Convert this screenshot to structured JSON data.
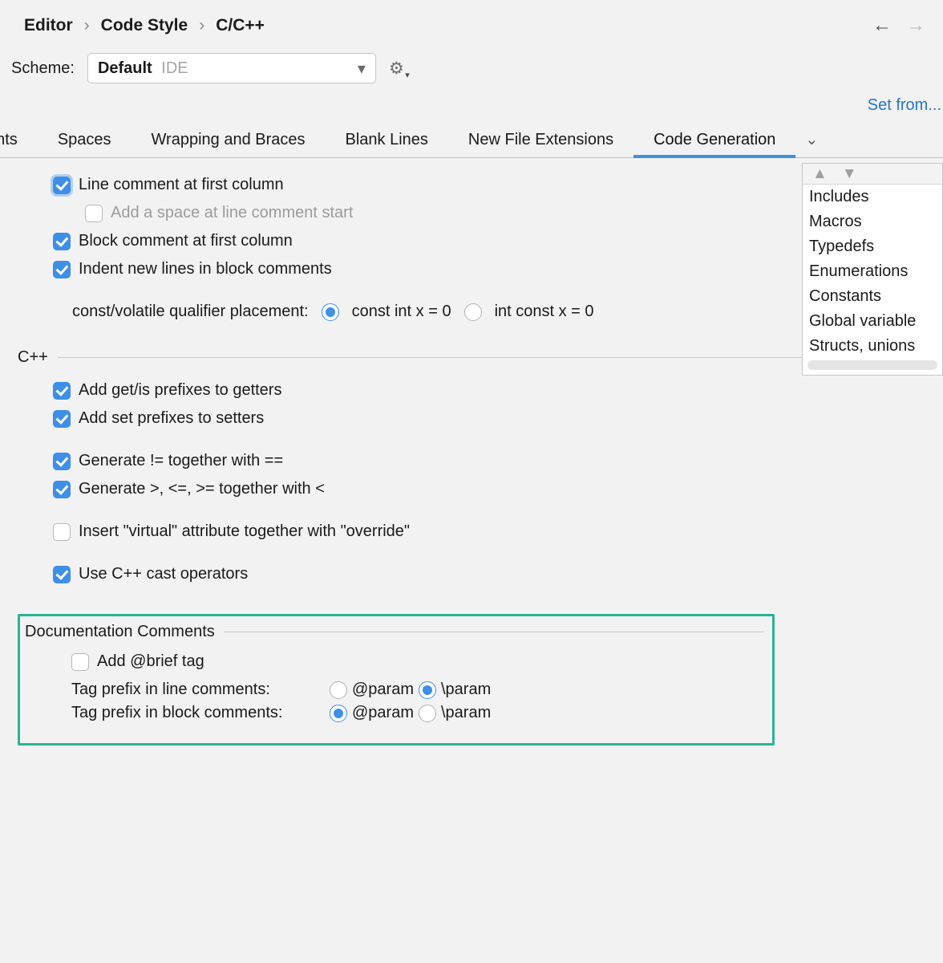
{
  "breadcrumb": [
    "Editor",
    "Code Style",
    "C/C++"
  ],
  "scheme": {
    "label": "Scheme:",
    "name": "Default",
    "suffix": "IDE"
  },
  "setFrom": "Set from...",
  "tabs": [
    "ents",
    "Spaces",
    "Wrapping and Braces",
    "Blank Lines",
    "New File Extensions",
    "Code Generation"
  ],
  "activeTab": 5,
  "options": {
    "lineCommentFirst": "Line comment at first column",
    "addSpaceLineComment": "Add a space at line comment start",
    "blockCommentFirst": "Block comment at first column",
    "indentBlockComments": "Indent new lines in block comments",
    "qualifierLabel": "const/volatile qualifier placement:",
    "qualifierA": "const int x = 0",
    "qualifierB": "int const x = 0"
  },
  "cppSection": "C++",
  "cpp": {
    "getIs": "Add get/is prefixes to getters",
    "set": "Add set prefixes to setters",
    "neq": "Generate != together with ==",
    "rel": "Generate >, <=, >= together with <",
    "virtual": "Insert \"virtual\" attribute together with \"override\"",
    "cast": "Use C++ cast operators"
  },
  "docSection": "Documentation Comments",
  "doc": {
    "brief": "Add @brief tag",
    "lineLabel": "Tag prefix in line comments:",
    "blockLabel": "Tag prefix in block comments:",
    "at": "@param",
    "bs": "\\param"
  },
  "sideItems": [
    "Includes",
    "Macros",
    "Typedefs",
    "Enumerations",
    "Constants",
    "Global variable",
    "Structs, unions"
  ]
}
